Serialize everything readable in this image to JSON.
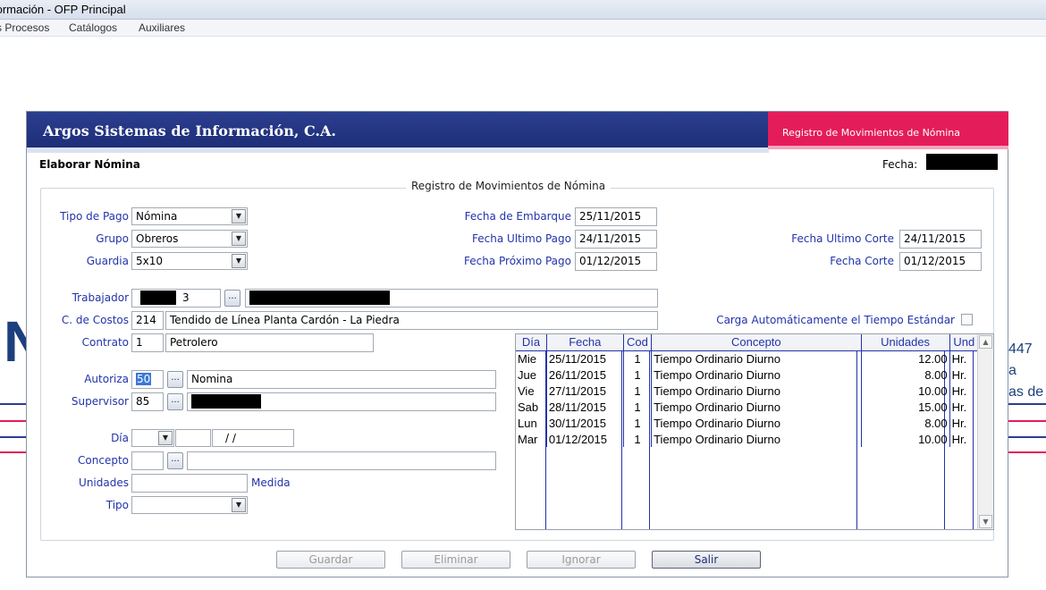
{
  "window_title": "formación - OFP Principal",
  "menu": [
    "s Procesos",
    "Catálogos",
    "Auxiliares"
  ],
  "background": {
    "letter": "N",
    "right_texts": [
      "447",
      "a",
      "as de"
    ]
  },
  "header": {
    "company": "Argos Sistemas de Información, C.A.",
    "module": "Registro de Movimientos de Nómina",
    "section": "Elaborar Nómina",
    "fecha_label": "Fecha:"
  },
  "form": {
    "group_title": "Registro de Movimientos de Nómina",
    "tipo_pago": {
      "label": "Tipo de Pago",
      "value": "Nómina"
    },
    "grupo": {
      "label": "Grupo",
      "value": "Obreros"
    },
    "guardia": {
      "label": "Guardia",
      "value": "5x10"
    },
    "fecha_embarque": {
      "label": "Fecha de Embarque",
      "value": "25/11/2015"
    },
    "fecha_ultimo_pago": {
      "label": "Fecha Ultimo Pago",
      "value": "24/11/2015"
    },
    "fecha_proximo_pago": {
      "label": "Fecha Próximo Pago",
      "value": "01/12/2015"
    },
    "fecha_ultimo_corte": {
      "label": "Fecha Ultimo Corte",
      "value": "24/11/2015"
    },
    "fecha_corte": {
      "label": "Fecha Corte",
      "value": "01/12/2015"
    },
    "trabajador": {
      "label": "Trabajador",
      "code_suffix": "3"
    },
    "centro_costos": {
      "label": "C. de Costos",
      "code": "214",
      "name": "Tendido de Línea Planta Cardón - La Piedra"
    },
    "carga_automatica": {
      "label": "Carga Automáticamente el Tiempo Estándar"
    },
    "contrato": {
      "label": "Contrato",
      "code": "1",
      "name": "Petrolero"
    },
    "autoriza": {
      "label": "Autoriza",
      "code": "50",
      "name": "Nomina"
    },
    "supervisor": {
      "label": "Supervisor",
      "code": "85"
    },
    "dia": {
      "label": "Día",
      "value": "/ /"
    },
    "concepto": {
      "label": "Concepto"
    },
    "unidades": {
      "label": "Unidades",
      "medida_label": "Medida"
    },
    "tipo": {
      "label": "Tipo"
    },
    "ellipsis": "..."
  },
  "grid": {
    "headers": [
      "Día",
      "Fecha",
      "Cod",
      "Concepto",
      "Unidades",
      "Und"
    ],
    "rows": [
      {
        "dia": "Mie",
        "fecha": "25/11/2015",
        "cod": "1",
        "concepto": "Tiempo Ordinario Diurno",
        "unidades": "12.00",
        "und": "Hr."
      },
      {
        "dia": "Jue",
        "fecha": "26/11/2015",
        "cod": "1",
        "concepto": "Tiempo Ordinario Diurno",
        "unidades": "8.00",
        "und": "Hr."
      },
      {
        "dia": "Vie",
        "fecha": "27/11/2015",
        "cod": "1",
        "concepto": "Tiempo Ordinario Diurno",
        "unidades": "10.00",
        "und": "Hr."
      },
      {
        "dia": "Sab",
        "fecha": "28/11/2015",
        "cod": "1",
        "concepto": "Tiempo Ordinario Diurno",
        "unidades": "15.00",
        "und": "Hr."
      },
      {
        "dia": "Lun",
        "fecha": "30/11/2015",
        "cod": "1",
        "concepto": "Tiempo Ordinario Diurno",
        "unidades": "8.00",
        "und": "Hr."
      },
      {
        "dia": "Mar",
        "fecha": "01/12/2015",
        "cod": "1",
        "concepto": "Tiempo Ordinario Diurno",
        "unidades": "10.00",
        "und": "Hr."
      }
    ]
  },
  "buttons": {
    "guardar": "Guardar",
    "eliminar": "Eliminar",
    "ignorar": "Ignorar",
    "salir": "Salir"
  },
  "colors": {
    "header_blue": "#1e2e78",
    "accent_pink": "#e41d5a",
    "label_blue": "#2233aa"
  }
}
